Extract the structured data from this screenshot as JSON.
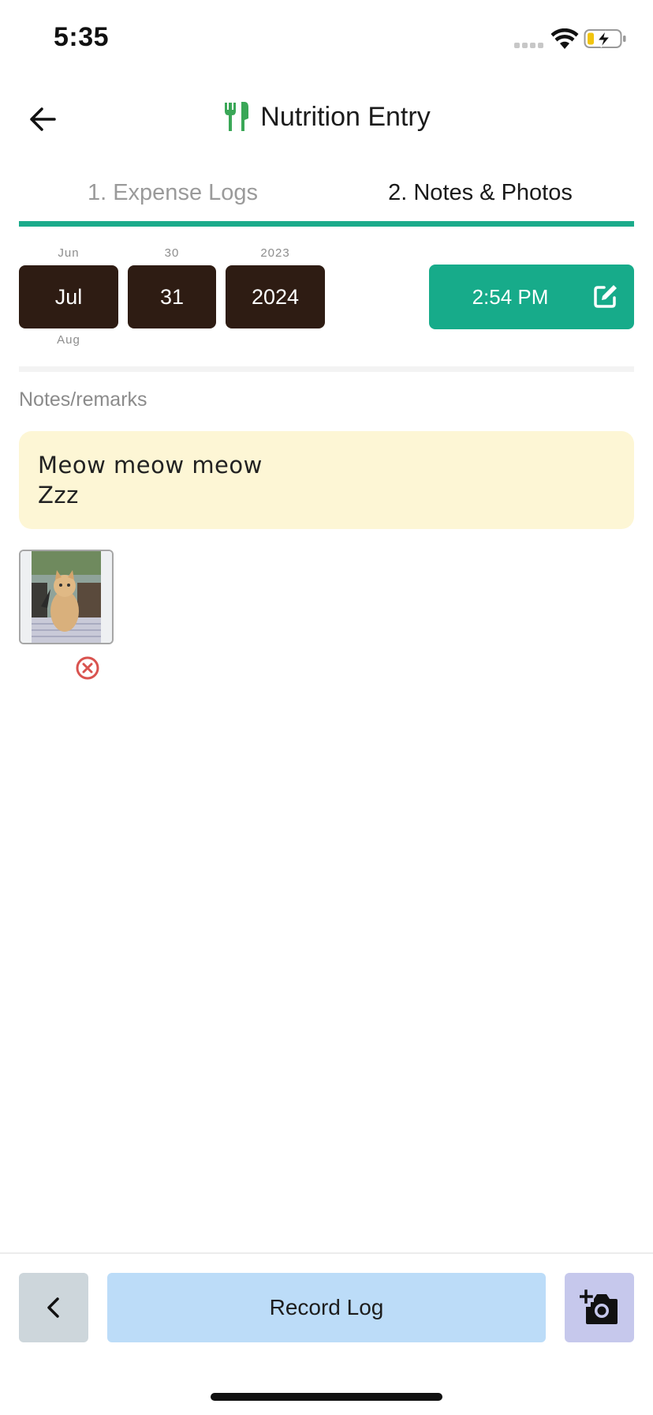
{
  "status_bar": {
    "time": "5:35",
    "icons": [
      "signal-icon",
      "wifi-icon",
      "battery-charging-icon"
    ]
  },
  "header": {
    "title": "Nutrition Entry",
    "title_icon": "fork-knife-icon",
    "back_icon": "arrow-left-icon"
  },
  "tabs": [
    {
      "label": "1. Expense Logs",
      "active": false
    },
    {
      "label": "2. Notes & Photos",
      "active": true
    }
  ],
  "accent_color": "#1bab8b",
  "date_picker": {
    "month": {
      "prev": "Jun",
      "value": "Jul",
      "next": "Aug"
    },
    "day": {
      "prev": "30",
      "value": "31"
    },
    "year": {
      "prev": "2023",
      "value": "2024"
    }
  },
  "time_button": {
    "value": "2:54 PM",
    "icon": "edit-icon"
  },
  "notes": {
    "label": "Notes/remarks",
    "value": "Meow meow meow\nZzz"
  },
  "photos": [
    {
      "alt": "cat photo",
      "remove_icon": "remove-circle-icon"
    }
  ],
  "bottom_bar": {
    "prev_icon": "chevron-left-icon",
    "record_label": "Record Log",
    "camera_icon": "add-photo-icon"
  }
}
